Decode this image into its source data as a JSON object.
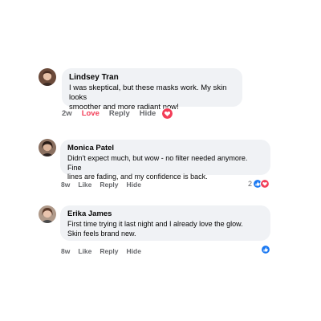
{
  "colors": {
    "bubble_bg": "#f0f2f5",
    "text": "#050505",
    "meta": "#65676b",
    "love": "#f33e58",
    "like": "#1877f2"
  },
  "comments": [
    {
      "author": "Lindsey Tran",
      "text": "I was skeptical, but these masks work. My skin looks\nsmoother and more radiant now!",
      "time": "2w",
      "action_react": "Love",
      "action_reply": "Reply",
      "action_hide": "Hide",
      "reactions": {
        "icons": [
          "heart-icon"
        ],
        "count": ""
      }
    },
    {
      "author": "Monica Patel",
      "text": "Didn't expect much, but wow - no filter needed anymore. Fine\nlines are fading, and my confidence is back.",
      "time": "8w",
      "action_react": "Like",
      "action_reply": "Reply",
      "action_hide": "Hide",
      "reactions": {
        "icons": [
          "thumbs-up-icon",
          "heart-icon"
        ],
        "count": "2"
      }
    },
    {
      "author": "Erika James",
      "text": "First time trying it last night and I already love the glow.\nSkin feels brand new.",
      "time": "8w",
      "action_react": "Like",
      "action_reply": "Reply",
      "action_hide": "Hide",
      "reactions": {
        "icons": [
          "thumbs-up-icon"
        ],
        "count": ""
      }
    }
  ]
}
